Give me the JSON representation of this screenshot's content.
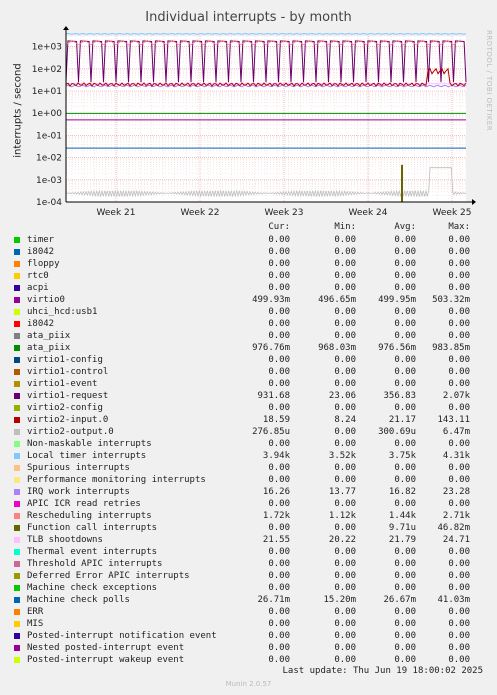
{
  "chart_data": {
    "type": "line",
    "title": "Individual interrupts - by month",
    "ylabel": "interrupts / second",
    "yscale": "log",
    "ylim": [
      0.0001,
      3000
    ],
    "yticks": [
      "1e+03",
      "1e+02",
      "1e+01",
      "1e+00",
      "1e-01",
      "1e-02",
      "1e-03",
      "1e-04"
    ],
    "xticks": [
      "Week 21",
      "Week 22",
      "Week 23",
      "Week 24",
      "Week 25"
    ],
    "grid": true,
    "legend_placement": "bottom",
    "columns": [
      "Cur:",
      "Min:",
      "Avg:",
      "Max:"
    ],
    "series": [
      {
        "name": "timer",
        "color": "#00cc00",
        "cur": "0.00",
        "min": "0.00",
        "avg": "0.00",
        "max": "0.00"
      },
      {
        "name": "i8042",
        "color": "#0066b3",
        "cur": "0.00",
        "min": "0.00",
        "avg": "0.00",
        "max": "0.00"
      },
      {
        "name": "floppy",
        "color": "#ff8000",
        "cur": "0.00",
        "min": "0.00",
        "avg": "0.00",
        "max": "0.00"
      },
      {
        "name": "rtc0",
        "color": "#ffcc00",
        "cur": "0.00",
        "min": "0.00",
        "avg": "0.00",
        "max": "0.00"
      },
      {
        "name": "acpi",
        "color": "#330099",
        "cur": "0.00",
        "min": "0.00",
        "avg": "0.00",
        "max": "0.00"
      },
      {
        "name": "virtio0",
        "color": "#990099",
        "cur": "499.93m",
        "min": "496.65m",
        "avg": "499.95m",
        "max": "503.32m"
      },
      {
        "name": "uhci_hcd:usb1",
        "color": "#ccff00",
        "cur": "0.00",
        "min": "0.00",
        "avg": "0.00",
        "max": "0.00"
      },
      {
        "name": "i8042",
        "color": "#ff0000",
        "cur": "0.00",
        "min": "0.00",
        "avg": "0.00",
        "max": "0.00"
      },
      {
        "name": "ata_piix",
        "color": "#808080",
        "cur": "0.00",
        "min": "0.00",
        "avg": "0.00",
        "max": "0.00"
      },
      {
        "name": "ata_piix",
        "color": "#008f00",
        "cur": "976.76m",
        "min": "968.03m",
        "avg": "976.56m",
        "max": "983.85m"
      },
      {
        "name": "virtio1-config",
        "color": "#00487d",
        "cur": "0.00",
        "min": "0.00",
        "avg": "0.00",
        "max": "0.00"
      },
      {
        "name": "virtio1-control",
        "color": "#b35a00",
        "cur": "0.00",
        "min": "0.00",
        "avg": "0.00",
        "max": "0.00"
      },
      {
        "name": "virtio1-event",
        "color": "#b38f00",
        "cur": "0.00",
        "min": "0.00",
        "avg": "0.00",
        "max": "0.00"
      },
      {
        "name": "virtio1-request",
        "color": "#6b006b",
        "cur": "931.68",
        "min": "23.06",
        "avg": "356.83",
        "max": "2.07k"
      },
      {
        "name": "virtio2-config",
        "color": "#8fb300",
        "cur": "0.00",
        "min": "0.00",
        "avg": "0.00",
        "max": "0.00"
      },
      {
        "name": "virtio2-input.0",
        "color": "#b30000",
        "cur": "18.59",
        "min": "8.24",
        "avg": "21.17",
        "max": "143.11"
      },
      {
        "name": "virtio2-output.0",
        "color": "#bebebe",
        "cur": "276.85u",
        "min": "0.00",
        "avg": "300.69u",
        "max": "6.47m"
      },
      {
        "name": "Non-maskable interrupts",
        "color": "#80ff80",
        "cur": "0.00",
        "min": "0.00",
        "avg": "0.00",
        "max": "0.00"
      },
      {
        "name": "Local timer interrupts",
        "color": "#80c9ff",
        "cur": "3.94k",
        "min": "3.52k",
        "avg": "3.75k",
        "max": "4.31k"
      },
      {
        "name": "Spurious interrupts",
        "color": "#ffc080",
        "cur": "0.00",
        "min": "0.00",
        "avg": "0.00",
        "max": "0.00"
      },
      {
        "name": "Performance monitoring interrupts",
        "color": "#ffe680",
        "cur": "0.00",
        "min": "0.00",
        "avg": "0.00",
        "max": "0.00"
      },
      {
        "name": "IRQ work interrupts",
        "color": "#aa80ff",
        "cur": "16.26",
        "min": "13.77",
        "avg": "16.82",
        "max": "23.28"
      },
      {
        "name": "APIC ICR read retries",
        "color": "#ee00cc",
        "cur": "0.00",
        "min": "0.00",
        "avg": "0.00",
        "max": "0.00"
      },
      {
        "name": "Rescheduling interrupts",
        "color": "#ff8080",
        "cur": "1.72k",
        "min": "1.12k",
        "avg": "1.44k",
        "max": "2.71k"
      },
      {
        "name": "Function call interrupts",
        "color": "#666600",
        "cur": "0.00",
        "min": "0.00",
        "avg": "9.71u",
        "max": "46.82m"
      },
      {
        "name": "TLB shootdowns",
        "color": "#ffbfff",
        "cur": "21.55",
        "min": "20.22",
        "avg": "21.79",
        "max": "24.71"
      },
      {
        "name": "Thermal event interrupts",
        "color": "#00ffcc",
        "cur": "0.00",
        "min": "0.00",
        "avg": "0.00",
        "max": "0.00"
      },
      {
        "name": "Threshold APIC interrupts",
        "color": "#cc6699",
        "cur": "0.00",
        "min": "0.00",
        "avg": "0.00",
        "max": "0.00"
      },
      {
        "name": "Deferred Error APIC interrupts",
        "color": "#999900",
        "cur": "0.00",
        "min": "0.00",
        "avg": "0.00",
        "max": "0.00"
      },
      {
        "name": "Machine check exceptions",
        "color": "#00cc00",
        "cur": "0.00",
        "min": "0.00",
        "avg": "0.00",
        "max": "0.00"
      },
      {
        "name": "Machine check polls",
        "color": "#0066b3",
        "cur": "26.71m",
        "min": "15.20m",
        "avg": "26.67m",
        "max": "41.03m"
      },
      {
        "name": "ERR",
        "color": "#ff8000",
        "cur": "0.00",
        "min": "0.00",
        "avg": "0.00",
        "max": "0.00"
      },
      {
        "name": "MIS",
        "color": "#ffcc00",
        "cur": "0.00",
        "min": "0.00",
        "avg": "0.00",
        "max": "0.00"
      },
      {
        "name": "Posted-interrupt notification event",
        "color": "#330099",
        "cur": "0.00",
        "min": "0.00",
        "avg": "0.00",
        "max": "0.00"
      },
      {
        "name": "Nested posted-interrupt event",
        "color": "#990099",
        "cur": "0.00",
        "min": "0.00",
        "avg": "0.00",
        "max": "0.00"
      },
      {
        "name": "Posted-interrupt wakeup event",
        "color": "#ccff00",
        "cur": "0.00",
        "min": "0.00",
        "avg": "0.00",
        "max": "0.00"
      }
    ]
  },
  "footer": {
    "last_update": "Last update: Thu Jun 19 18:00:02 2025",
    "munin": "Munin 2.0.57",
    "side_credit": "RRDTOOL / TOBI OETIKER"
  }
}
